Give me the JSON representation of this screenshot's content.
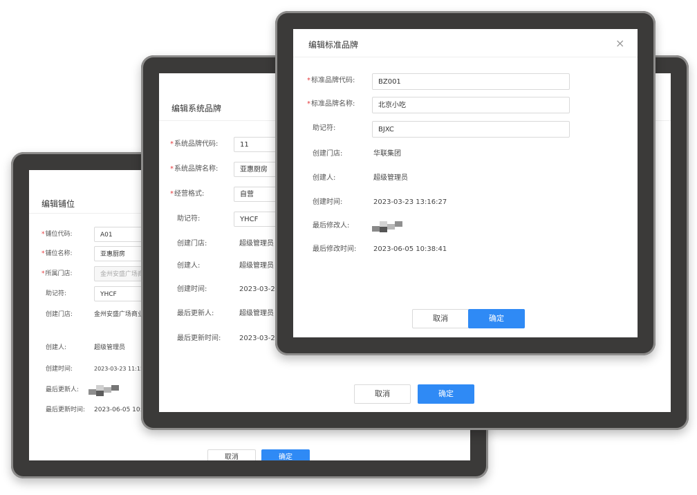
{
  "colors": {
    "accent": "#2f8af5",
    "required": "#e4393c",
    "frame": "#3b3a39"
  },
  "req_mark": "*",
  "dialog_stall": {
    "title": "编辑铺位",
    "fields": [
      {
        "label": "铺位代码:",
        "value": "A01",
        "required": true
      },
      {
        "label": "铺位名称:",
        "value": "亚惠厨房",
        "required": true
      },
      {
        "label": "所属门店:",
        "value": "金州安盛广场商业广",
        "required": true,
        "disabled": true
      },
      {
        "label": "助记符:",
        "value": "YHCF"
      }
    ],
    "info": [
      {
        "label": "创建门店:",
        "value": "金州安盛广场商业广场"
      },
      {
        "label": "创建人:",
        "value": "超级管理员"
      },
      {
        "label": "创建时间:",
        "value": "2023-03-23 11:15"
      },
      {
        "label": "最后更新人:",
        "value": ""
      },
      {
        "label": "最后更新时间:",
        "value": "2023-06-05 10:38"
      }
    ],
    "cancel_label": "取消",
    "ok_label": "确定"
  },
  "dialog_system_brand": {
    "title": "编辑系统品牌",
    "fields": [
      {
        "label": "系统品牌代码:",
        "value": "11",
        "required": true
      },
      {
        "label": "系统品牌名称:",
        "value": "亚惠厨房",
        "required": true
      },
      {
        "label": "经营格式:",
        "value": "自营",
        "required": true
      },
      {
        "label": "助记符:",
        "value": "YHCF"
      }
    ],
    "info": [
      {
        "label": "创建门店:",
        "value": "超级管理员"
      },
      {
        "label": "创建人:",
        "value": "超级管理员"
      },
      {
        "label": "创建时间:",
        "value": "2023-03-23 11"
      },
      {
        "label": "最后更新人:",
        "value": "超级管理员"
      },
      {
        "label": "最后更新时间:",
        "value": "2023-03-23 14"
      }
    ],
    "cancel_label": "取消",
    "ok_label": "确定"
  },
  "dialog_standard_brand": {
    "title": "编辑标准品牌",
    "close_glyph": "×",
    "fields": [
      {
        "label": "标准品牌代码:",
        "value": "BZ001",
        "required": true
      },
      {
        "label": "标准品牌名称:",
        "value": "北京小吃",
        "required": true
      },
      {
        "label": "助记符:",
        "value": "BJXC"
      }
    ],
    "info": [
      {
        "label": "创建门店:",
        "value": "华联集团"
      },
      {
        "label": "创建人:",
        "value": "超级管理员"
      },
      {
        "label": "创建时间:",
        "value": "2023-03-23 13:16:27"
      },
      {
        "label": "最后修改人:",
        "value": ""
      },
      {
        "label": "最后修改时间:",
        "value": "2023-06-05 10:38:41"
      }
    ],
    "cancel_label": "取消",
    "ok_label": "确定"
  }
}
